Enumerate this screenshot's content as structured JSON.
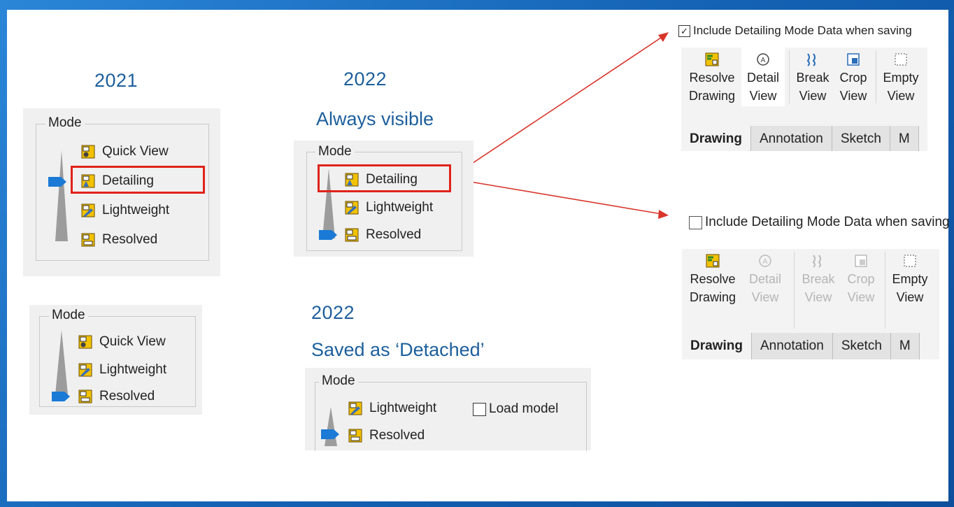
{
  "left_2021": {
    "year": "2021",
    "mode_label": "Mode",
    "items": [
      "Quick View",
      "Detailing",
      "Lightweight",
      "Resolved"
    ]
  },
  "left_2021_b": {
    "mode_label": "Mode",
    "items": [
      "Quick View",
      "Lightweight",
      "Resolved"
    ]
  },
  "mid_2022_visible": {
    "year": "2022",
    "subtitle": "Always visible",
    "mode_label": "Mode",
    "items": [
      "Detailing",
      "Lightweight",
      "Resolved"
    ]
  },
  "mid_2022_detached": {
    "year": "2022",
    "subtitle": "Saved as ‘Detached’",
    "mode_label": "Mode",
    "items": [
      "Lightweight",
      "Resolved"
    ],
    "load_model_label": "Load model",
    "load_model_checked": false
  },
  "right_checked": {
    "checkbox_label": "Include Detailing Mode Data when saving",
    "checked": true,
    "buttons": [
      {
        "l1": "Resolve",
        "l2": "Drawing",
        "icon": "resolve-drawing-icon"
      },
      {
        "l1": "Detail",
        "l2": "View",
        "icon": "detail-view-icon"
      },
      {
        "l1": "Break",
        "l2": "View",
        "icon": "break-view-icon"
      },
      {
        "l1": "Crop",
        "l2": "View",
        "icon": "crop-view-icon"
      },
      {
        "l1": "Empty",
        "l2": "View",
        "icon": "empty-view-icon"
      }
    ],
    "tabs": [
      "Drawing",
      "Annotation",
      "Sketch",
      "M"
    ]
  },
  "right_unchecked": {
    "checkbox_label": "Include Detailing Mode Data when saving",
    "checked": false,
    "buttons": [
      {
        "l1": "Resolve",
        "l2": "Drawing",
        "icon": "resolve-drawing-icon"
      },
      {
        "l1": "Detail",
        "l2": "View",
        "icon": "detail-view-icon"
      },
      {
        "l1": "Break",
        "l2": "View",
        "icon": "break-view-icon"
      },
      {
        "l1": "Crop",
        "l2": "View",
        "icon": "crop-view-icon"
      },
      {
        "l1": "Empty",
        "l2": "View",
        "icon": "empty-view-icon"
      }
    ],
    "tabs": [
      "Drawing",
      "Annotation",
      "Sketch",
      "M"
    ]
  },
  "colors": {
    "highlight_box": "#e0231b",
    "arrow": "#d9362b",
    "marker": "#1a7ad6",
    "title": "#1d5f9c"
  }
}
